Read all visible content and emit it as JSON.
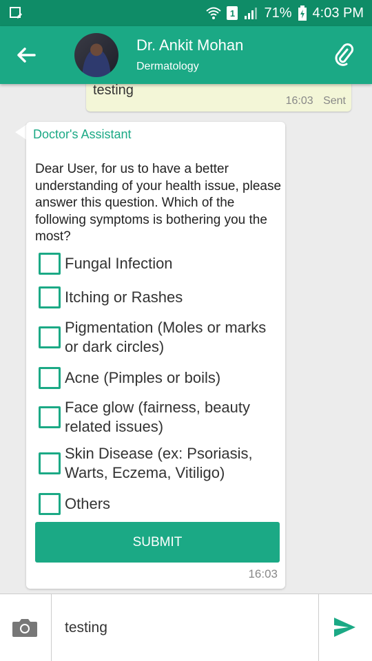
{
  "status_bar": {
    "sim_slot": "1",
    "battery": "71%",
    "time": "4:03 PM"
  },
  "header": {
    "doctor_name": "Dr. Ankit Mohan",
    "specialty": "Dermatology"
  },
  "sent_message": {
    "text": "testing",
    "time": "16:03",
    "status": "Sent"
  },
  "assistant_message": {
    "sender": "Doctor's Assistant",
    "question": "Dear User, for us to have a better understanding of your health issue, please answer this question. Which of the following symptoms is bothering you the most?",
    "options": [
      "Fungal Infection",
      "Itching or Rashes",
      "Pigmentation (Moles or marks or dark circles)",
      "Acne (Pimples or boils)",
      "Face glow (fairness, beauty related issues)",
      "Skin Disease (ex: Psoriasis, Warts, Eczema, Vitiligo)",
      "Others"
    ],
    "submit_label": "SUBMIT",
    "time": "16:03"
  },
  "composer": {
    "value": "testing"
  },
  "colors": {
    "status_bar": "#0f8c67",
    "app_bar": "#1ba985",
    "accent": "#1ba985",
    "sent_bubble": "#f3f6d7"
  }
}
